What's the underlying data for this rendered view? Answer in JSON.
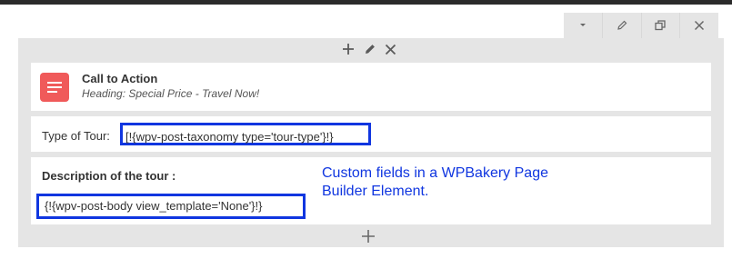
{
  "toolbar": {
    "buttons": [
      {
        "icon": "chevron-down-icon"
      },
      {
        "icon": "pencil-icon"
      },
      {
        "icon": "clone-icon"
      },
      {
        "icon": "close-icon"
      }
    ]
  },
  "row": {
    "controls": [
      "plus-icon",
      "pencil-icon",
      "close-icon"
    ],
    "add_icon": "plus-icon"
  },
  "element": {
    "title": "Call to Action",
    "subtitle": "Heading: Special Price - Travel Now!",
    "icon_color": "#f05a5a"
  },
  "type_field": {
    "label": "Type of Tour:",
    "value": "[!{wpv-post-taxonomy type='tour-type'}!}"
  },
  "description_field": {
    "label": "Description of the tour :",
    "value": "{!{wpv-post-body view_template='None'}!}"
  },
  "annotation": {
    "text": "Custom fields in a WPBakery Page Builder Element.",
    "color": "#1036e0"
  },
  "highlight_color": "#1036e0"
}
